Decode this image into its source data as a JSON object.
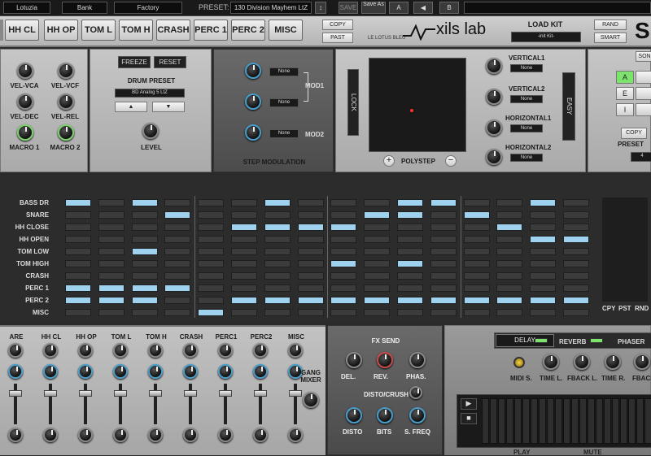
{
  "topbar": {
    "user": "Lotuzia",
    "bank": "Bank",
    "factory": "Factory",
    "preset_label": "PRESET:",
    "preset_name": "130 Division Mayhem LtZ",
    "save": "SAVE",
    "save_as": "Save As",
    "a": "A",
    "b": "B"
  },
  "header": {
    "tabs": [
      "HH CL",
      "HH OP",
      "TOM L",
      "TOM H",
      "CRASH",
      "PERC 1",
      "PERC 2",
      "MISC"
    ],
    "copy": "COPY",
    "past": "PAST",
    "brand_small": "LE LOTUS BLEU",
    "brand": "xils lab",
    "load_kit": "LOAD KIT",
    "kit_name": "-init Kit-",
    "rand": "RAND",
    "smart": "SMART"
  },
  "voice": {
    "vel_vca": "VEL-VCA",
    "vel_vcf": "VEL-VCF",
    "vel_dec": "VEL-DEC",
    "vel_rel": "VEL-REL",
    "macro1": "MACRO 1",
    "macro2": "MACRO 2"
  },
  "drum_preset": {
    "freeze": "FREEZE",
    "reset": "RESET",
    "title": "DRUM PRESET",
    "value": "BD Analog 5 LtZ",
    "level": "LEVEL"
  },
  "step_mod": {
    "title": "STEP MODULATION",
    "none": "None",
    "mod1": "MOD1",
    "mod2": "MOD2"
  },
  "polystep": {
    "lock": "LOCK",
    "title": "POLYSTEP",
    "vertical1": "VERTICAL1",
    "vertical2": "VERTICAL2",
    "horizontal1": "HORIZONTAL1",
    "horizontal2": "HORIZONTAL2",
    "none": "None",
    "easy": "EASY"
  },
  "right_panel": {
    "son": "SON",
    "a": "A",
    "e": "E",
    "i": "I",
    "copy": "COPY",
    "preset": "PRESET",
    "num": "4"
  },
  "sequencer": {
    "rows": [
      "BASS DR",
      "SNARE",
      "HH CLOSE",
      "HH OPEN",
      "TOM LOW",
      "TOM HIGH",
      "CRASH",
      "PERC 1",
      "PERC 2",
      "MISC"
    ],
    "cpy": "CPY",
    "pst": "PST",
    "rnd": "RND"
  },
  "mixer": {
    "channels": [
      "ARE",
      "HH CL",
      "HH OP",
      "TOM L",
      "TOM H",
      "CRASH",
      "PERC1",
      "PERC2",
      "MISC"
    ],
    "gang": "GANG MIXER"
  },
  "fx_send": {
    "title": "FX SEND",
    "del": "DEL.",
    "rev": "REV.",
    "phas": "PHAS.",
    "disto_crush": "DISTO/CRUSH",
    "disto": "DISTO",
    "bits": "BITS",
    "sfreq": "S. FREQ"
  },
  "fx": {
    "delay": "DELAY",
    "reverb": "REVERB",
    "phaser": "PHASER",
    "midi_s": "MIDI S.",
    "time_l": "TIME L.",
    "fback_l": "FBACK L.",
    "time_r": "TIME R.",
    "fback_r": "FBACK",
    "play": "PLAY",
    "mute": "MUTE"
  }
}
